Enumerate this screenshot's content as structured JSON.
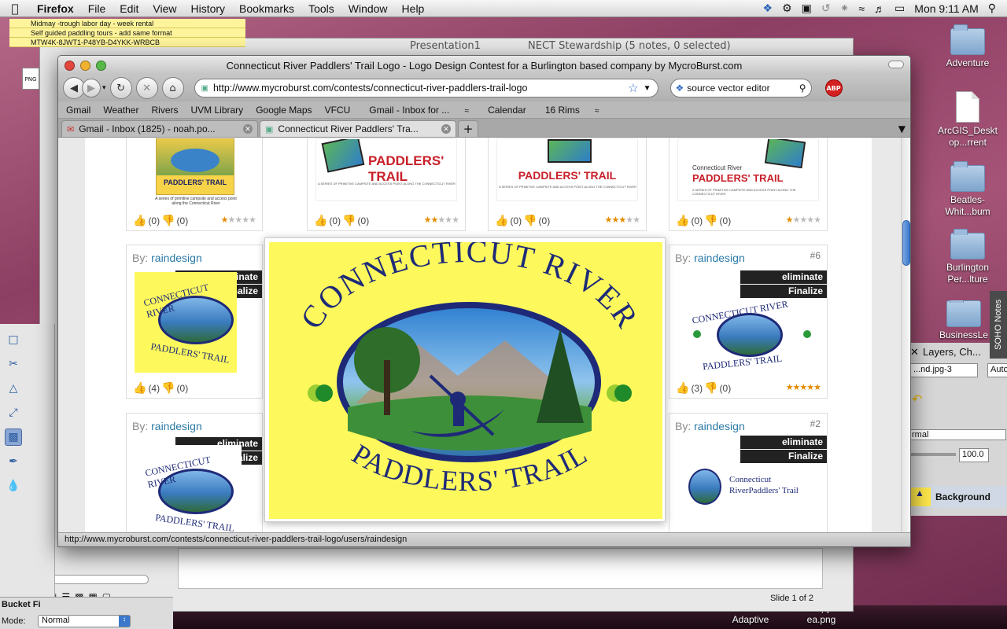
{
  "menubar": {
    "app": "Firefox",
    "items": [
      "File",
      "Edit",
      "View",
      "History",
      "Bookmarks",
      "Tools",
      "Window",
      "Help"
    ],
    "clock": "Mon 9:11 AM"
  },
  "stickies": [
    "Midmay -trough labor day - week rental",
    "Self guided paddling tours - add same format",
    "MTW4K-8JWT1-P48YB-D4YKK-WRBCB"
  ],
  "background_windows": {
    "presentation_title": "Presentation1",
    "notes_title": "NECT Stewardship (5 notes, 0 selected)",
    "slide_status": "Slide 1 of 2",
    "bucket_label": "Bucket Fi",
    "mode_label": "Mode:",
    "mode_value": "Normal",
    "layers_title": "Layers, Ch...",
    "layer_file": "...nd.jpg-3",
    "layer_mode": "rmal",
    "opacity": "100.0",
    "layer_name": "Background",
    "auto_label": "Auto",
    "soho_notes": "SOHO Notes"
  },
  "desktop_icons": [
    {
      "label": "Adventure",
      "type": "folder"
    },
    {
      "label": "ArcGIS_Deskt op...rrent",
      "type": "doc"
    },
    {
      "label": "Beatles-Whit...bum",
      "type": "folder"
    },
    {
      "label": "Burlington Per...lture",
      "type": "folder"
    },
    {
      "label": "BusinessLe",
      "type": "folder"
    },
    {
      "label": "Vermont Adaptive",
      "type": "text"
    },
    {
      "label": "ScampysAr ea.png",
      "type": "text"
    }
  ],
  "browser": {
    "window_title": "Connecticut River Paddlers' Trail Logo - Logo Design Contest for a Burlington based company by MycroBurst.com",
    "url": "http://www.mycroburst.com/contests/connecticut-river-paddlers-trail-logo",
    "search_query": "source vector editor",
    "abp_label": "ABP",
    "bookmarks": [
      "Gmail",
      "Weather",
      "Rivers",
      "UVM Library",
      "Google Maps",
      "VFCU",
      "Gmail - Inbox for ...",
      "Calendar",
      "16 Rims"
    ],
    "tabs": [
      {
        "title": "Gmail - Inbox (1825) - noah.po...",
        "active": false
      },
      {
        "title": "Connecticut River Paddlers' Tra...",
        "active": true
      }
    ],
    "status_url": "http://www.mycroburst.com/contests/connecticut-river-paddlers-trail-logo/users/raindesign"
  },
  "contest": {
    "by_prefix": "By:",
    "designer": "raindesign",
    "eliminate": "eliminate",
    "finalize": "Finalize",
    "row1": [
      {
        "up": "(0)",
        "down": "(0)",
        "stars": 1,
        "thumb_text": "PADDLERS' TRAIL",
        "thumb_sub": "A series of primitive campsite and access point along the Connecticut River"
      },
      {
        "up": "(0)",
        "down": "(0)",
        "stars": 2,
        "thumb_text": "PADDLERS' TRAIL",
        "thumb_sub": "A SERIES OF PRIMITIVE CAMPSITE AND ACCESS POINT ALONG THE CONNECTICUT RIVER"
      },
      {
        "up": "(0)",
        "down": "(0)",
        "stars": 3,
        "thumb_text": "PADDLERS' TRAIL",
        "thumb_sub": "A SERIES OF PRIMITIVE CAMPSITE AND ACCESS POINT ALONG THE CONNECTICUT RIVER"
      },
      {
        "up": "(0)",
        "down": "(0)",
        "stars": 1,
        "thumb_text": "PADDLERS' TRAIL",
        "thumb_top": "Connecticut River",
        "thumb_sub": "A SERIES OF PRIMITIVE CAMPSITE AND ACCESS POINT ALONG THE CONNECTICUT RIVER"
      }
    ],
    "row2_left": {
      "up": "(4)",
      "down": "(0)"
    },
    "row2_right": {
      "number": "#6",
      "up": "(3)",
      "down": "(0)",
      "stars": 5
    },
    "row3_right": {
      "number": "#2",
      "logo_line1": "Connecticut",
      "logo_line2": "RiverPaddlers' Trail"
    },
    "popup": {
      "arc_top": "CONNECTICUT RIVER",
      "arc_bottom": "PADDLERS' TRAIL"
    },
    "small_logo": {
      "arc_top": "CONNECTICUT RIVER",
      "arc_bottom": "PADDLERS' TRAIL"
    }
  },
  "colors": {
    "accent_blue": "#2a7aa6",
    "logo_yellow": "#fdf95c",
    "logo_navy": "#1e2a78"
  }
}
